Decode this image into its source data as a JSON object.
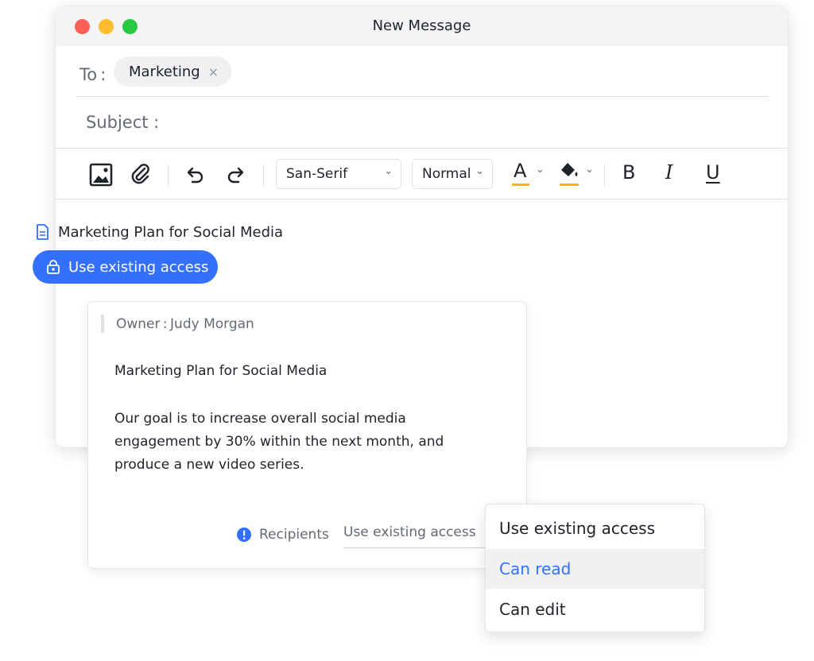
{
  "window": {
    "title": "New Message"
  },
  "to": {
    "label": "To :",
    "recipient": "Marketing",
    "remove_glyph": "×"
  },
  "subject": {
    "label": "Subject :"
  },
  "toolbar": {
    "font_family": "San-Serif",
    "font_size": "Normal",
    "text_color_glyph": "A",
    "bold": "B",
    "italic": "I",
    "underline": "U",
    "accent": "#f5b400"
  },
  "attachment": {
    "doc_title": "Marketing Plan for Social Media",
    "access_button": "Use existing access"
  },
  "card": {
    "owner": "Owner : Judy Morgan",
    "title": "Marketing Plan for Social Media",
    "body": "Our goal is to increase overall social media engagement by 30% within the next month, and produce a new video series.",
    "recipients_label": "Recipients",
    "recipients_value": "Use existing access"
  },
  "access_menu": {
    "options": [
      "Use existing access",
      "Can read",
      "Can edit"
    ],
    "highlighted": "Can read"
  },
  "colors": {
    "primary": "#3370ff",
    "chip_bg": "#eff0f1"
  }
}
